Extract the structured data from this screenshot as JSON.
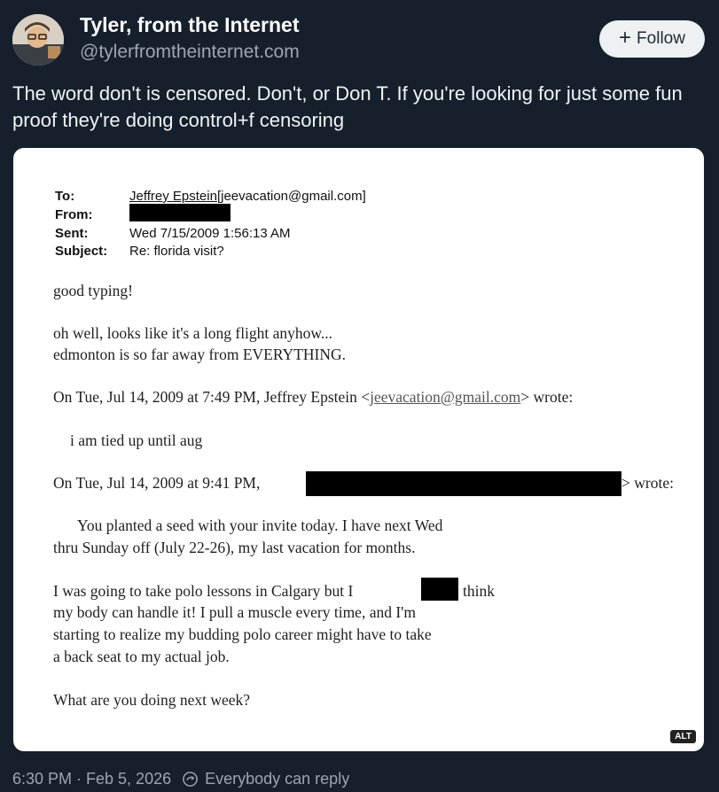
{
  "author": {
    "name": "Tyler, from the Internet",
    "handle": "@tylerfromtheinternet.com"
  },
  "follow": {
    "label": "Follow",
    "icon": "plus-icon"
  },
  "post": {
    "text": "The word don't is censored. Don't, or Don T. If you're looking for just some fun proof they're doing control+f censoring"
  },
  "email": {
    "to_label": "To:",
    "to_value": "Jeffrey Epstein[jeevacation@gmail.com]",
    "from_label": "From:",
    "sent_label": "Sent:",
    "sent_value": "Wed 7/15/2009 1:56:13 AM",
    "subject_label": "Subject:",
    "subject_value": "Re: florida visit?",
    "line1": "good typing!",
    "line2": "oh well, looks like it's a long flight anyhow...",
    "line3": "edmonton is so far away from EVERYTHING.",
    "quote1_prefix": "On Tue, Jul 14, 2009 at 7:49 PM, Jeffrey Epstein <",
    "quote1_email": "jeevacation@gmail.com",
    "quote1_suffix": "> wrote:",
    "quote1_body": "i am tied up until aug",
    "quote2_prefix": "On Tue, Jul 14, 2009 at 9:41 PM,",
    "quote2_suffix": "> wrote:",
    "para1_line1": "You planted a seed with your invite today. I have next Wed",
    "para1_line2": "thru Sunday off (July 22-26), my last vacation for months.",
    "para2_line1a": "I was going to take polo lessons in Calgary but I",
    "para2_line1b": "think",
    "para2_line2": "my body can handle it! I pull a muscle every time, and I'm",
    "para2_line3": "starting to realize my budding polo career might have to take",
    "para2_line4": "a back seat to my actual job.",
    "closing": "What are you doing next week?"
  },
  "alt_badge": "ALT",
  "footer": {
    "timestamp": "6:30 PM · Feb 5, 2026",
    "reply_setting": "Everybody can reply"
  },
  "colors": {
    "background": "#16202c",
    "muted_text": "#9aa6b3",
    "follow_button": "#eef1f4"
  }
}
